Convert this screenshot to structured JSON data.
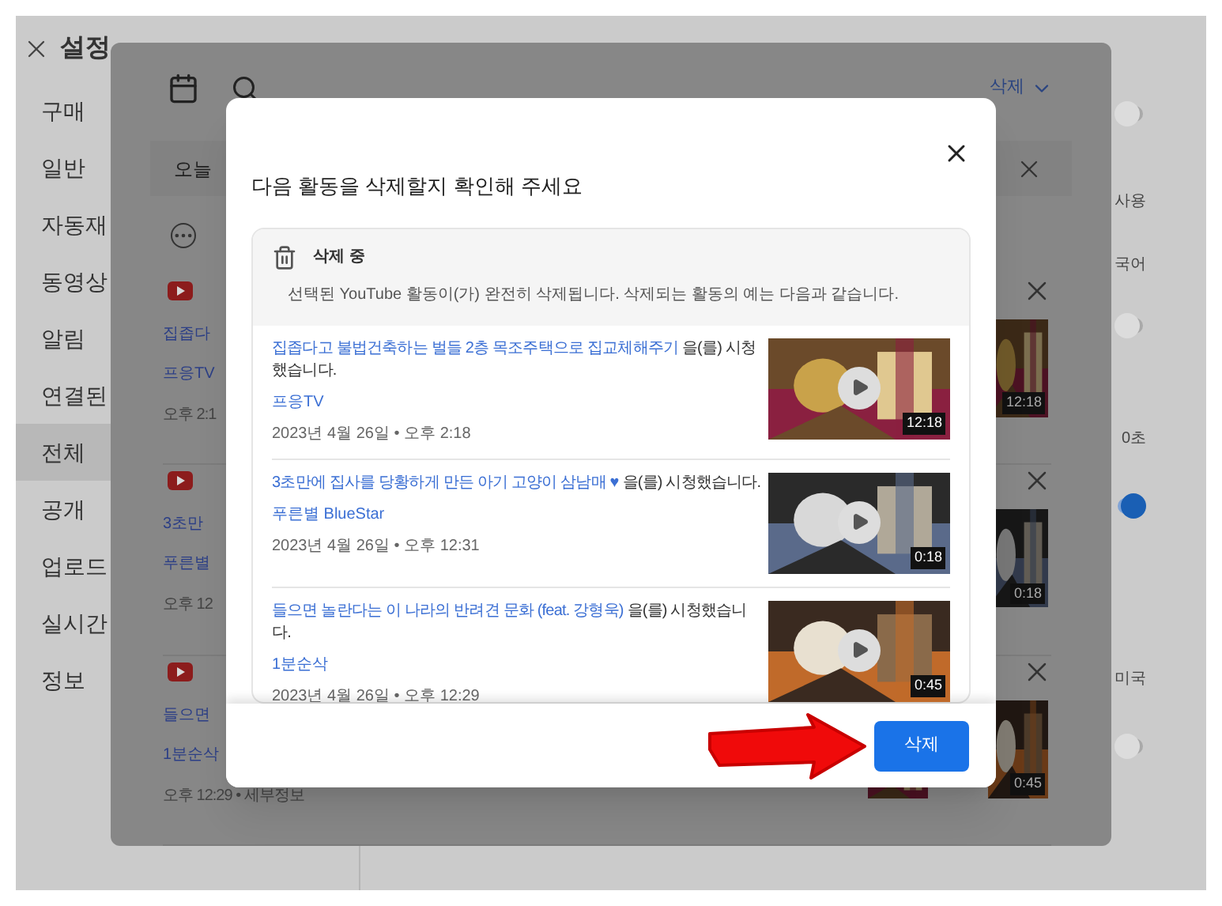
{
  "settings": {
    "title": "설정",
    "menu": [
      {
        "label": "구매",
        "selected": false
      },
      {
        "label": "일반",
        "selected": false
      },
      {
        "label": "자동재",
        "selected": false
      },
      {
        "label": "동영상",
        "selected": false
      },
      {
        "label": "알림",
        "selected": false
      },
      {
        "label": "연결된",
        "selected": false
      },
      {
        "label": "전체",
        "selected": true
      },
      {
        "label": "공개",
        "selected": false
      },
      {
        "label": "업로드",
        "selected": false
      },
      {
        "label": "실시간",
        "selected": false
      },
      {
        "label": "정보",
        "selected": false
      }
    ],
    "options": [
      {
        "kind": "toggle",
        "on": false
      },
      {
        "kind": "label",
        "text": "사용"
      },
      {
        "kind": "label",
        "text": "국어"
      },
      {
        "kind": "toggle",
        "on": false
      },
      {
        "kind": "label",
        "text": "0초"
      },
      {
        "kind": "toggle",
        "on": true
      },
      {
        "kind": "label",
        "text": "미국"
      },
      {
        "kind": "toggle",
        "on": false
      }
    ]
  },
  "activity_panel": {
    "delete_menu": "삭제",
    "date_header": "오늘",
    "rows": [
      {
        "title": "집좁다",
        "channel": "프응TV",
        "time": "오후 2:1",
        "duration": "12:18"
      },
      {
        "title": "3초만",
        "channel": "푸른별",
        "time": "오후 12",
        "duration": "0:18"
      },
      {
        "title": "들으면",
        "channel": "1분순삭",
        "time": "오후 12:29 • 세부정보",
        "duration": "0:45"
      }
    ]
  },
  "dialog": {
    "title": "다음 활동을 삭제할지 확인해 주세요",
    "notice_title": "삭제 중",
    "notice_text": "선택된 YouTube 활동이(가) 완전히 삭제됩니다. 삭제되는 활동의 예는 다음과 같습니다.",
    "items": [
      {
        "title": "집좁다고 불법건축하는 벌들 2층 목조주택으로 집교체해주기",
        "suffix": "을(를) 시청했습니다.",
        "channel": "프응TV",
        "date": "2023년 4월 26일 • 오후 2:18",
        "duration": "12:18"
      },
      {
        "title": "3초만에 집사를 당황하게 만든 아기 고양이 삼남매 ♥",
        "suffix": "을(를) 시청했습니다.",
        "channel": "푸른별 BlueStar",
        "date": "2023년 4월 26일 • 오후 12:31",
        "duration": "0:18"
      },
      {
        "title": "들으면 놀란다는 이 나라의 반려견 문화 (feat. 강형욱)",
        "suffix": "을(를) 시청했습니다.",
        "channel": "1분순삭",
        "date": "2023년 4월 26일 • 오후 12:29",
        "duration": "0:45"
      }
    ],
    "confirm_button": "삭제"
  }
}
